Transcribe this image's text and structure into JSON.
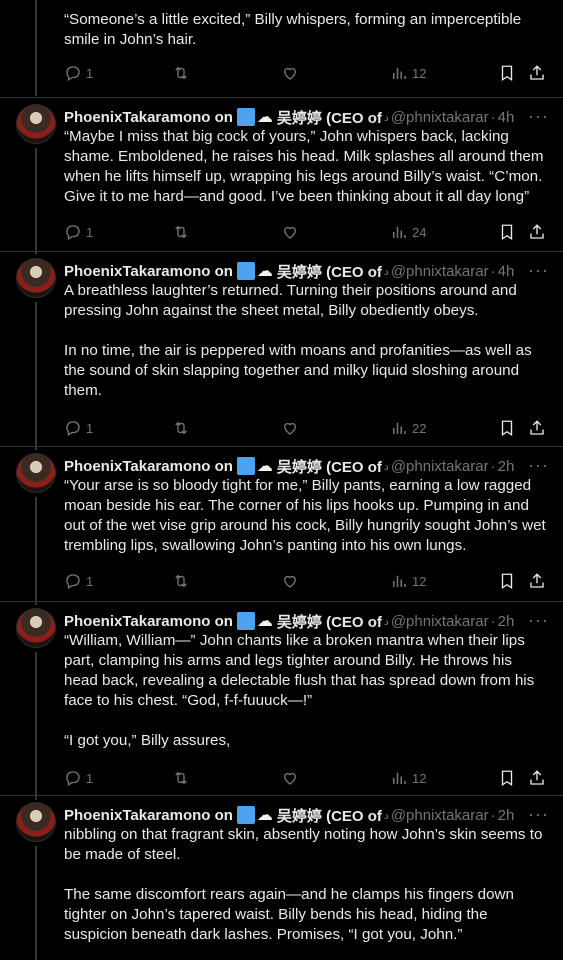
{
  "colors": {
    "background": "#000000",
    "text": "#e7e9ea",
    "muted": "#71767b",
    "divider": "#2f3336",
    "badge_blue": "#4ba3f0"
  },
  "first_tweet": {
    "text": "“Someone’s a little excited,” Billy whispers, forming an imperceptible smile in John’s hair.",
    "replies": "1",
    "retweets": "",
    "likes": "",
    "views": "12"
  },
  "author": {
    "name": "PhoenixTakaramono on",
    "cjk_name": "吴婷婷 (CEO of",
    "small_mark": "ﺩ",
    "handle": "@phnixtakarar"
  },
  "tweets": [
    {
      "time": "4h",
      "paragraphs": [
        "“Maybe I miss that big cock of yours,” John whispers back, lacking shame. Emboldened, he raises his head. Milk splashes all around them when he lifts himself up, wrapping his legs around Billy’s waist. “C’mon. Give it to me hard—and good. I’ve been thinking about it all day long”"
      ],
      "handle": "@phnixtakarar",
      "replies": "1",
      "views": "24"
    },
    {
      "time": "4h",
      "paragraphs": [
        "A breathless laughter’s returned. Turning their positions around and pressing John against the sheet metal, Billy obediently obeys.",
        "In no time, the air is peppered with moans and profanities—as well as the sound of skin slapping together and milky liquid sloshing around them."
      ],
      "handle": "@phnixtakarar",
      "replies": "1",
      "views": "22"
    },
    {
      "time": "2h",
      "paragraphs": [
        "“Your arse is so bloody tight for me,” Billy pants, earning a low ragged moan beside his ear. The corner of his lips hooks up. Pumping in and out of the wet vise grip around his cock, Billy hungrily sought John’s wet trembling lips, swallowing John’s panting into his own lungs."
      ],
      "handle": "@phnixtakarar",
      "replies": "1",
      "views": "12"
    },
    {
      "time": "2h",
      "paragraphs": [
        "“William, William—” John chants like a broken mantra when their lips part, clamping his arms and legs tighter around Billy. He throws his head back, revealing a delectable flush that has spread down from his face to his chest. “God, f-f-fuuuck—!”",
        "“I got you,” Billy assures,"
      ],
      "handle": "@phnixtakarar",
      "replies": "1",
      "views": "12"
    },
    {
      "time": "2h",
      "paragraphs": [
        "nibbling on that fragrant skin, absently noting how John’s skin seems to be made of steel.",
        "The same discomfort rears again—and he clamps his fingers down tighter on John’s tapered waist. Billy bends his head, hiding the suspicion beneath dark lashes. Promises, “I got you, John.”"
      ],
      "handle": "@phnixtakarar",
      "replies": "",
      "views": ""
    }
  ],
  "icons": {
    "reply": "reply-icon",
    "retweet": "retweet-icon",
    "like": "heart-icon",
    "views": "views-icon",
    "bookmark": "bookmark-icon",
    "share": "share-icon",
    "more": "more-icon",
    "verified": "blue-square-badge",
    "cloud": "cloud-emoji"
  }
}
